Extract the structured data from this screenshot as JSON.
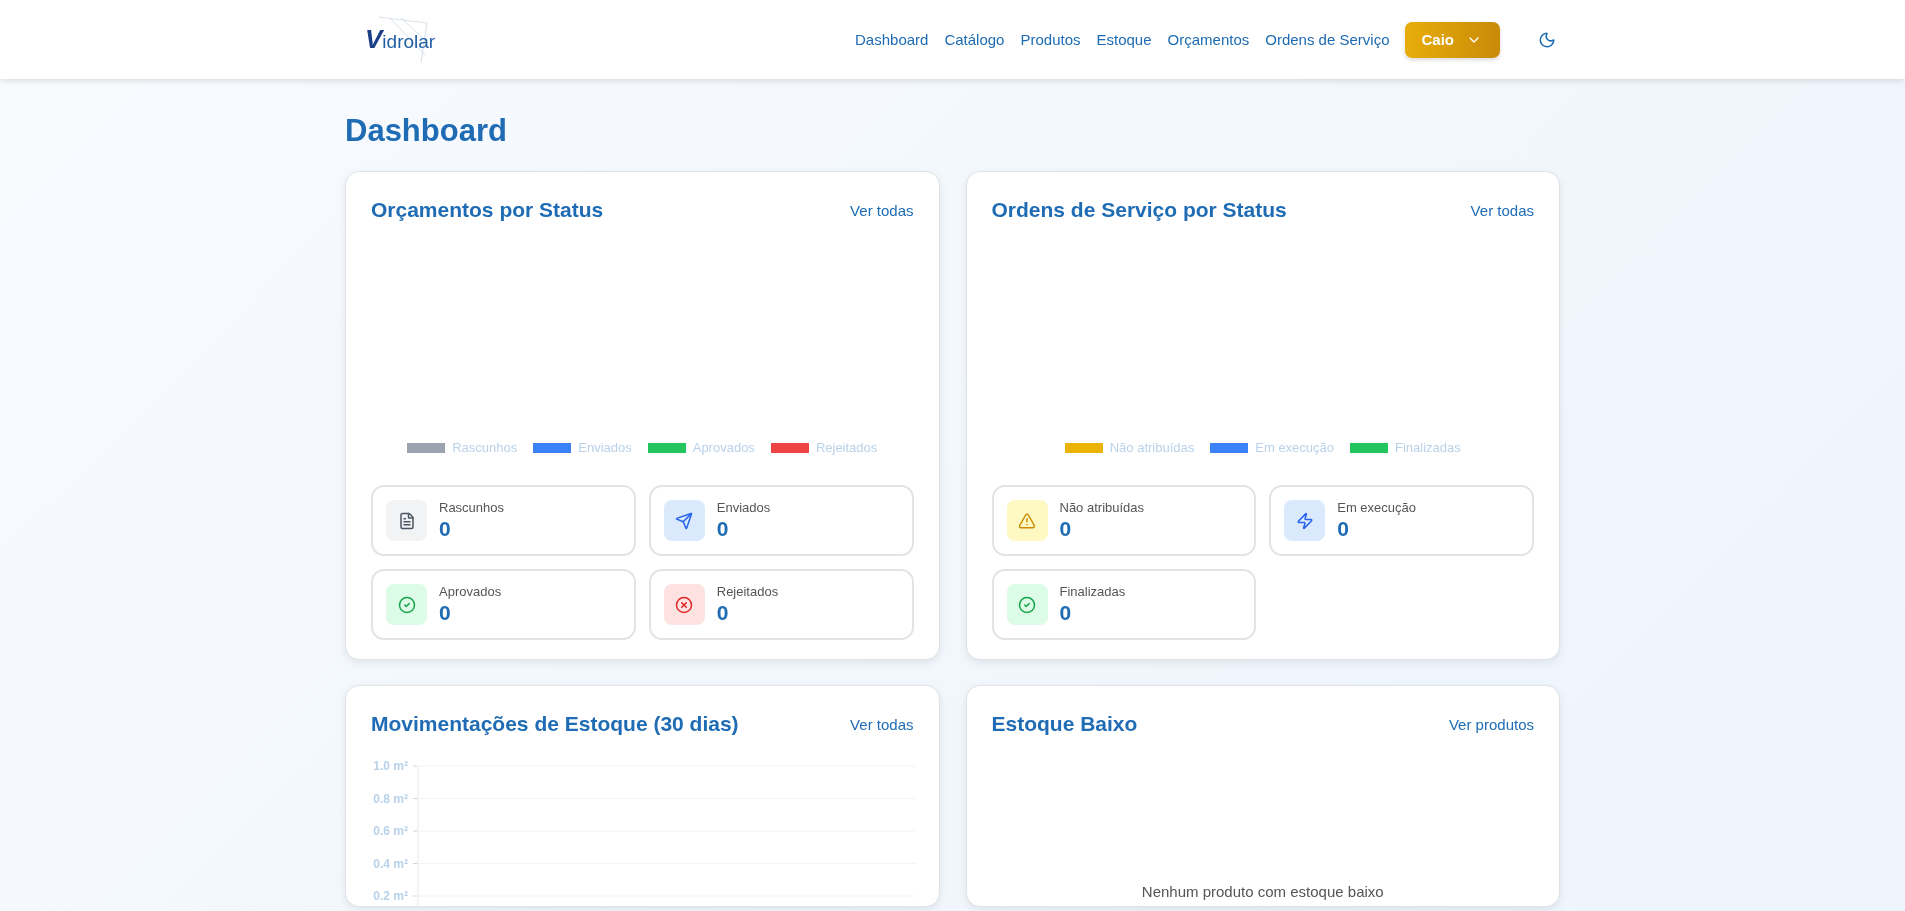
{
  "header": {
    "logo": "**V**idrolar",
    "nav": [
      {
        "label": "Dashboard"
      },
      {
        "label": "Catálogo"
      },
      {
        "label": "Produtos"
      },
      {
        "label": "Estoque"
      },
      {
        "label": "Orçamentos"
      },
      {
        "label": "Ordens de Serviço"
      }
    ],
    "user_button": "Caio"
  },
  "page_title": "Dashboard",
  "cards": [
    {
      "kind": "status",
      "title": "Orçamentos por Status",
      "link": "Ver todas",
      "legend": [
        {
          "label": "Rascunhos",
          "color": "#9ca3af"
        },
        {
          "label": "Enviados",
          "color": "#3b82f6"
        },
        {
          "label": "Aprovados",
          "color": "#22c55e"
        },
        {
          "label": "Rejeitados",
          "color": "#ef4444"
        }
      ],
      "stats": [
        {
          "kind": "draft",
          "label": "Rascunhos",
          "value": "0"
        },
        {
          "kind": "sent",
          "label": "Enviados",
          "value": "0"
        },
        {
          "kind": "approved",
          "label": "Aprovados",
          "value": "0"
        },
        {
          "kind": "rejected",
          "label": "Rejeitados",
          "value": "0"
        }
      ]
    },
    {
      "kind": "status",
      "title": "Ordens de Serviço por Status",
      "link": "Ver todas",
      "legend": [
        {
          "label": "Não atribuídas",
          "color": "#eab308"
        },
        {
          "label": "Em execução",
          "color": "#3b82f6"
        },
        {
          "label": "Finalizadas",
          "color": "#22c55e"
        }
      ],
      "stats": [
        {
          "kind": "warning",
          "label": "Não atribuídas",
          "value": "0"
        },
        {
          "kind": "running",
          "label": "Em execução",
          "value": "0"
        },
        {
          "kind": "approved",
          "label": "Finalizadas",
          "value": "0"
        }
      ]
    },
    {
      "kind": "chart",
      "title": "Movimentações de Estoque (30 dias)",
      "link": "Ver todas",
      "axis_labels": [
        "1.0 m²",
        "0.8 m²",
        "0.6 m²",
        "0.4 m²",
        "0.2 m²"
      ]
    },
    {
      "kind": "empty",
      "title": "Estoque Baixo",
      "link": "Ver produtos",
      "message": "Nenhum produto com estoque baixo"
    }
  ]
}
